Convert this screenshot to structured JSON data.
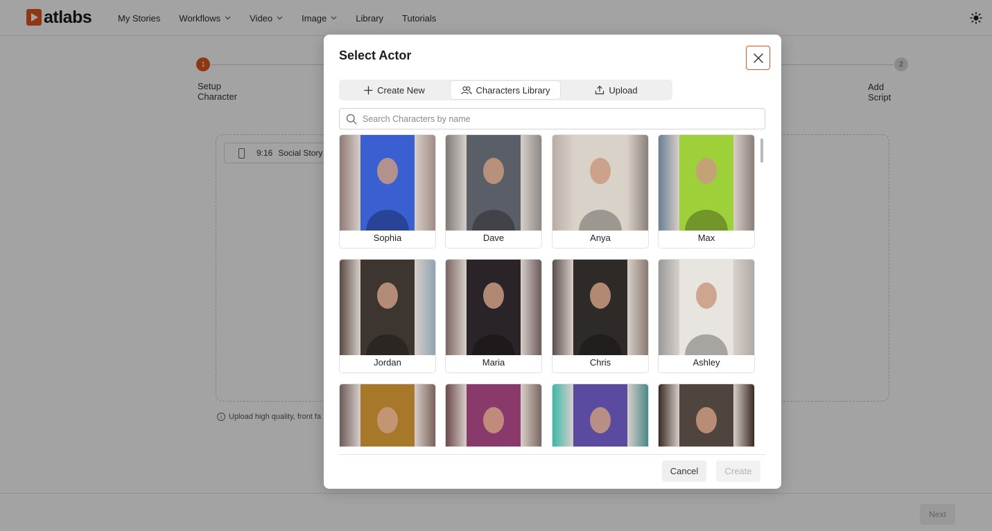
{
  "app": {
    "logo_text": "atlabs",
    "brand_color": "#e0561b"
  },
  "nav": {
    "items": [
      {
        "label": "My Stories",
        "has_dropdown": false
      },
      {
        "label": "Workflows",
        "has_dropdown": true
      },
      {
        "label": "Video",
        "has_dropdown": true
      },
      {
        "label": "Image",
        "has_dropdown": true
      },
      {
        "label": "Library",
        "has_dropdown": false
      },
      {
        "label": "Tutorials",
        "has_dropdown": false
      }
    ],
    "theme_icon": "sun-icon"
  },
  "stepper": {
    "steps": [
      {
        "number": "1",
        "label": "Setup Character",
        "active": true
      },
      {
        "number": "2",
        "label": "Add Script",
        "active": false
      }
    ]
  },
  "setup": {
    "ratio": "9:16",
    "ratio_label": "Social Story",
    "upload_hint": "Upload high quality, front fa"
  },
  "footer": {
    "next_label": "Next"
  },
  "modal": {
    "title": "Select Actor",
    "tabs": [
      {
        "label": "Create New",
        "icon": "plus-icon",
        "active": false
      },
      {
        "label": "Characters Library",
        "icon": "users-icon",
        "active": true
      },
      {
        "label": "Upload",
        "icon": "upload-icon",
        "active": false
      }
    ],
    "search": {
      "placeholder": "Search Characters by name",
      "value": ""
    },
    "characters": [
      {
        "name": "Sophia",
        "colors": [
          "#8e7b74",
          "#3a5fd0",
          "#a08b86"
        ]
      },
      {
        "name": "Dave",
        "colors": [
          "#7d7b78",
          "#5a5e66",
          "#8c8985"
        ]
      },
      {
        "name": "Anya",
        "colors": [
          "#b8aea6",
          "#d9d2c8",
          "#8a817a"
        ]
      },
      {
        "name": "Max",
        "colors": [
          "#6a7d93",
          "#9ed03a",
          "#8a7e78"
        ]
      },
      {
        "name": "Jordan",
        "colors": [
          "#5a4a40",
          "#3d3530",
          "#8fa3b0"
        ]
      },
      {
        "name": "Maria",
        "colors": [
          "#7a6660",
          "#2a2428",
          "#6a5a5a"
        ]
      },
      {
        "name": "Chris",
        "colors": [
          "#5a4f4a",
          "#2e2a28",
          "#8a7a70"
        ]
      },
      {
        "name": "Ashley",
        "colors": [
          "#9a9a9a",
          "#e8e4e0",
          "#b0aaa6"
        ]
      },
      {
        "name": "",
        "colors": [
          "#6a5a58",
          "#a8782a",
          "#7a6058"
        ]
      },
      {
        "name": "",
        "colors": [
          "#6a4a4a",
          "#8a3a6a",
          "#7a6860"
        ]
      },
      {
        "name": "",
        "colors": [
          "#3ab8a8",
          "#5a4aa0",
          "#4a8888"
        ]
      },
      {
        "name": "",
        "colors": [
          "#3a2a22",
          "#50453e",
          "#3a2a22"
        ]
      }
    ],
    "cancel_label": "Cancel",
    "create_label": "Create"
  }
}
